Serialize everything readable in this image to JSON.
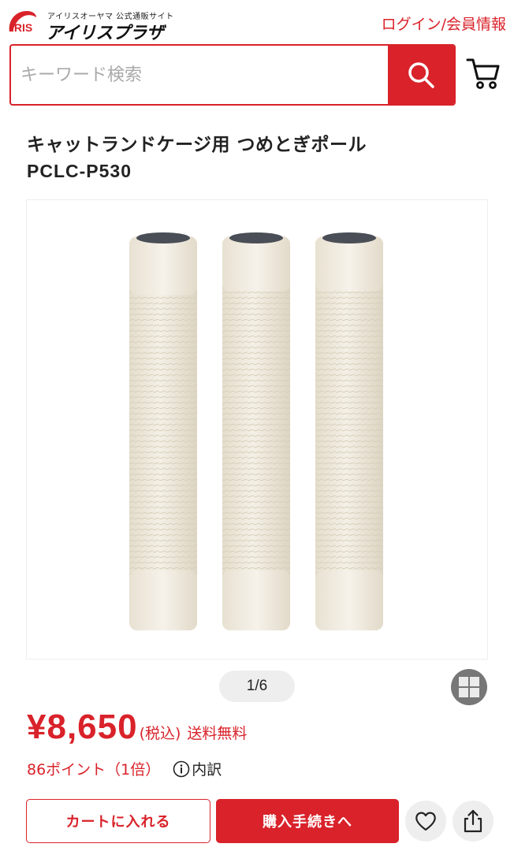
{
  "header": {
    "logo_mark": "IRIS",
    "logo_small": "アイリスオーヤマ 公式通販サイト",
    "logo_big": "アイリスプラザ",
    "login_label": "ログイン/会員情報"
  },
  "search": {
    "placeholder": "キーワード検索",
    "button_icon": "search-icon",
    "cart_icon": "cart-icon"
  },
  "product": {
    "name": "キャットランドケージ用 つめとぎポール",
    "code": "PCLC-P530"
  },
  "gallery": {
    "pager": "1/6",
    "grid_icon": "grid-icon"
  },
  "price": {
    "amount": "¥8,650",
    "tax_note": "(税込)",
    "shipping": "送料無料"
  },
  "points": {
    "text": "86ポイント（1倍）",
    "info_icon": "info-icon",
    "breakdown_label": "内訳"
  },
  "actions": {
    "add_to_cart": "カートに入れる",
    "checkout": "購入手続きへ",
    "favorite_icon": "heart-icon",
    "share_icon": "share-icon"
  },
  "colors": {
    "brand_red": "#d9222a",
    "pill_gray": "#eeeeee"
  }
}
